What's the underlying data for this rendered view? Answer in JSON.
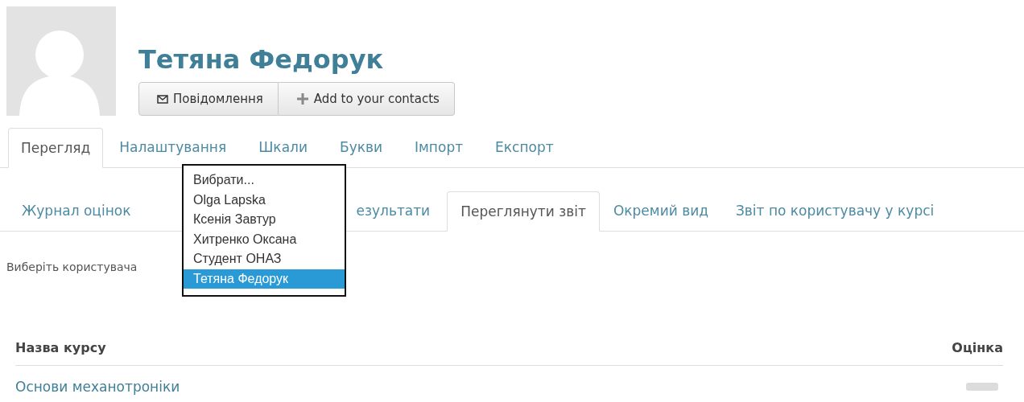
{
  "profile": {
    "name": "Тетяна Федорук",
    "buttons": [
      {
        "kind": "message",
        "label": "Повідомлення"
      },
      {
        "kind": "add",
        "label": "Add to your contacts"
      }
    ]
  },
  "main_tabs": [
    {
      "label": "Перегляд",
      "selected": true
    },
    {
      "label": "Налаштування",
      "selected": false
    },
    {
      "label": "Шкали",
      "selected": false
    },
    {
      "label": "Букви",
      "selected": false
    },
    {
      "label": "Імпорт",
      "selected": false
    },
    {
      "label": "Експорт",
      "selected": false
    }
  ],
  "sub_tabs": [
    {
      "label": "Журнал оцінок",
      "selected": false
    },
    {
      "label": "езультати",
      "selected": false
    },
    {
      "label": "Переглянути звіт",
      "selected": true
    },
    {
      "label": "Окремий вид",
      "selected": false
    },
    {
      "label": "Звіт по користувачу у курсі",
      "selected": false
    }
  ],
  "user_select": {
    "label": "Виберіть користувача",
    "options": [
      {
        "label": "Вибрати...",
        "selected": false
      },
      {
        "label": "Olga Lapska",
        "selected": false
      },
      {
        "label": "Ксенія Завтур",
        "selected": false
      },
      {
        "label": "Хитренко Оксана",
        "selected": false
      },
      {
        "label": "Студент ОНАЗ",
        "selected": false
      },
      {
        "label": "Тетяна Федорук",
        "selected": true
      }
    ]
  },
  "table": {
    "columns": [
      "Назва курсу",
      "Оцінка"
    ],
    "rows": [
      {
        "course": "Основи механотроніки",
        "grade_redacted": true
      }
    ]
  }
}
